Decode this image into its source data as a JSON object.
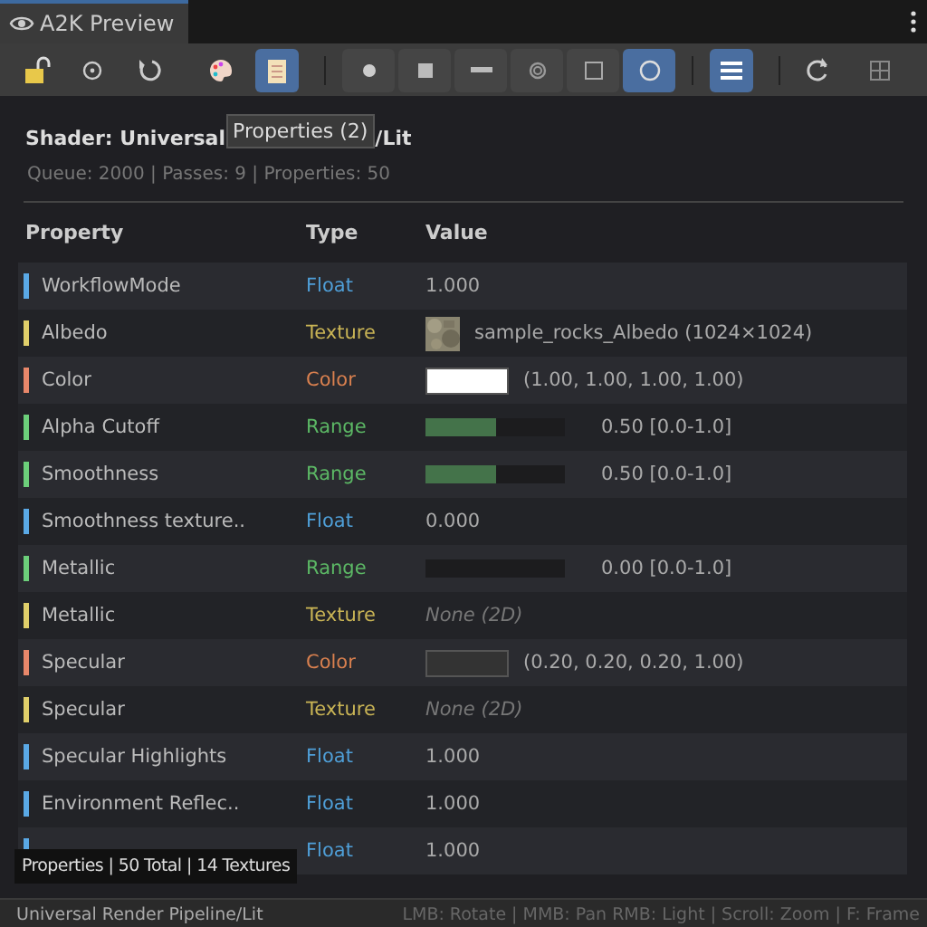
{
  "window": {
    "title": "A2K Preview"
  },
  "toolbar": {
    "groups": [
      [
        {
          "kind": "lock",
          "selected": false
        },
        {
          "kind": "target",
          "selected": false
        },
        {
          "kind": "undo",
          "selected": false
        },
        {
          "kind": "palette",
          "selected": false
        },
        {
          "kind": "clipboard",
          "selected": true
        }
      ],
      [
        {
          "kind": "sphere",
          "selected": false
        },
        {
          "kind": "cube",
          "selected": false
        },
        {
          "kind": "plane",
          "selected": false
        },
        {
          "kind": "torus",
          "selected": false
        },
        {
          "kind": "quad",
          "selected": false
        },
        {
          "kind": "circle",
          "selected": true
        }
      ],
      [
        {
          "kind": "list",
          "selected": true
        }
      ],
      [
        {
          "kind": "refresh",
          "selected": false
        },
        {
          "kind": "grid",
          "selected": false
        }
      ]
    ]
  },
  "header": {
    "shader_visible_start": "Shader: Universal",
    "shader_visible_end": "/Lit",
    "tooltip": "Properties (2)",
    "stats": "Queue: 2000 | Passes: 9 | Properties: 50"
  },
  "table": {
    "columns": [
      "Property",
      "Type",
      "Value"
    ],
    "rows": [
      {
        "name": "WorkflowMode",
        "type": "Float",
        "kind": "float",
        "value": "1.000"
      },
      {
        "name": "Albedo",
        "type": "Texture",
        "kind": "texture",
        "assigned": true,
        "value": "sample_rocks_Albedo (1024×1024)"
      },
      {
        "name": "Color",
        "type": "Color",
        "kind": "color",
        "color": "#ffffff",
        "value": "(1.00, 1.00, 1.00, 1.00)"
      },
      {
        "name": "Alpha Cutoff",
        "type": "Range",
        "kind": "range",
        "level": 0.5,
        "value": "0.50 [0.0-1.0]"
      },
      {
        "name": "Smoothness",
        "type": "Range",
        "kind": "range",
        "level": 0.5,
        "value": "0.50 [0.0-1.0]"
      },
      {
        "name": "Smoothness texture..",
        "type": "Float",
        "kind": "float",
        "value": "0.000"
      },
      {
        "name": "Metallic",
        "type": "Range",
        "kind": "range",
        "level": 0,
        "value": "0.00 [0.0-1.0]"
      },
      {
        "name": "Metallic",
        "type": "Texture",
        "kind": "texture",
        "assigned": false,
        "value": "None (2D)"
      },
      {
        "name": "Specular",
        "type": "Color",
        "kind": "color",
        "color": "#333333",
        "value": "(0.20, 0.20, 0.20, 1.00)"
      },
      {
        "name": "Specular",
        "type": "Texture",
        "kind": "texture",
        "assigned": false,
        "value": "None (2D)"
      },
      {
        "name": "Specular Highlights",
        "type": "Float",
        "kind": "float",
        "value": "1.000"
      },
      {
        "name": "Environment Reflec..",
        "type": "Float",
        "kind": "float",
        "value": "1.000"
      },
      {
        "type": "Float",
        "kind": "float",
        "value": "1.000"
      }
    ]
  },
  "overlay": "Properties | 50 Total | 14 Textures",
  "status_bar": {
    "shader": "Universal Render Pipeline/Lit",
    "hints": "LMB: Rotate | MMB: Pan  RMB: Light | Scroll: Zoom | F: Frame"
  }
}
